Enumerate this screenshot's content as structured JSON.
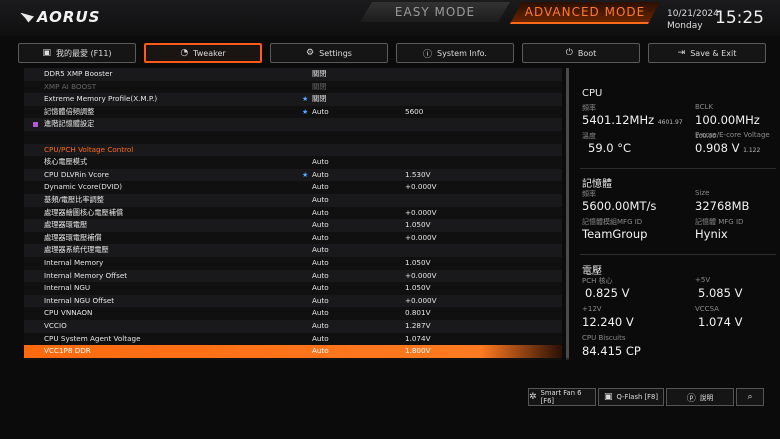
{
  "header": {
    "brand": "AORUS",
    "mode_easy": "EASY MODE",
    "mode_advanced": "ADVANCED MODE",
    "date": "10/21/2024",
    "weekday": "Monday",
    "time": "15:25"
  },
  "tabs": [
    {
      "label": "我的最愛 (F11)",
      "icon": "folder-icon"
    },
    {
      "label": "Tweaker",
      "icon": "gauge-icon",
      "active": true
    },
    {
      "label": "Settings",
      "icon": "gear-icon"
    },
    {
      "label": "System Info.",
      "icon": "info-icon"
    },
    {
      "label": "Boot",
      "icon": "power-icon"
    },
    {
      "label": "Save & Exit",
      "icon": "exit-icon"
    }
  ],
  "rows": [
    {
      "label": "DDR5 XMP Booster",
      "value": "關閉",
      "extra": ""
    },
    {
      "label": "XMP AI BOOST",
      "value": "關閉",
      "extra": "",
      "dim": true
    },
    {
      "label": "Extreme Memory Profile(X.M.P.)",
      "value": "關閉",
      "extra": "",
      "star": true
    },
    {
      "label": "記憶體倍頻調整",
      "value": "Auto",
      "extra": "5600",
      "star": true
    },
    {
      "label": "進階記憶體設定",
      "value": "",
      "extra": "",
      "sub": true
    },
    {
      "label": "",
      "value": "",
      "extra": ""
    },
    {
      "label": "CPU/PCH Voltage Control",
      "value": "",
      "extra": "",
      "section": true
    },
    {
      "label": "核心電壓模式",
      "value": "Auto",
      "extra": ""
    },
    {
      "label": "CPU DLVRin Vcore",
      "value": "Auto",
      "extra": "1.530V",
      "star": true
    },
    {
      "label": "Dynamic Vcore(DVID)",
      "value": "Auto",
      "extra": "+0.000V"
    },
    {
      "label": "基頻/電壓比率調整",
      "value": "Auto",
      "extra": ""
    },
    {
      "label": "處理器繪圖核心電壓補償",
      "value": "Auto",
      "extra": "+0.000V"
    },
    {
      "label": "處理器環電壓",
      "value": "Auto",
      "extra": "1.050V"
    },
    {
      "label": "處理器環電壓補償",
      "value": "Auto",
      "extra": "+0.000V"
    },
    {
      "label": "處理器系統代理電壓",
      "value": "Auto",
      "extra": ""
    },
    {
      "label": "Internal Memory",
      "value": "Auto",
      "extra": "1.050V"
    },
    {
      "label": "Internal Memory Offset",
      "value": "Auto",
      "extra": "+0.000V"
    },
    {
      "label": "Internal NGU",
      "value": "Auto",
      "extra": "1.050V"
    },
    {
      "label": "Internal NGU Offset",
      "value": "Auto",
      "extra": "+0.000V"
    },
    {
      "label": "CPU VNNAON",
      "value": "Auto",
      "extra": "0.801V"
    },
    {
      "label": "VCCIO",
      "value": "Auto",
      "extra": "1.287V"
    },
    {
      "label": "CPU System Agent Voltage",
      "value": "Auto",
      "extra": "1.074V"
    },
    {
      "label": "VCC1P8 DDR",
      "value": "Auto",
      "extra": "1.800V",
      "highlight": true
    }
  ],
  "sidebar": {
    "cpu": {
      "title": "CPU",
      "freq_label": "頻率",
      "freq_value": "5401.12MHz",
      "freq_sub": "4601.97",
      "bclk_label": "BCLK",
      "bclk_value": "100.00MHz",
      "bclk_sub": "100.00",
      "temp_label": "溫度",
      "temp_value": "59.0 °C",
      "pe_label": "P-core/E-core Voltage",
      "pe_value": "0.908 V",
      "pe_sub": "1.122"
    },
    "memory": {
      "title": "記憶體",
      "freq_label": "頻率",
      "freq_value": "5600.00MT/s",
      "size_label": "Size",
      "size_value": "32768MB",
      "mfg1_label": "記憶體模組MFG ID",
      "mfg1_value": "TeamGroup",
      "mfg2_label": "記憶體 MFG ID",
      "mfg2_value": "Hynix"
    },
    "voltage": {
      "title": "電壓",
      "pch_label": "PCH 核心",
      "pch_value": "0.825 V",
      "p5_label": "+5V",
      "p5_value": "5.085 V",
      "p12_label": "+12V",
      "p12_value": "12.240 V",
      "vccsa_label": "VCCSA",
      "vccsa_value": "1.074 V",
      "biscuits_label": "CPU Biscuits",
      "biscuits_value": "84.415 CP"
    }
  },
  "bottom": {
    "smartfan": "Smart Fan 6 [F6]",
    "qflash": "Q-Flash [F8]",
    "help": "說明"
  }
}
